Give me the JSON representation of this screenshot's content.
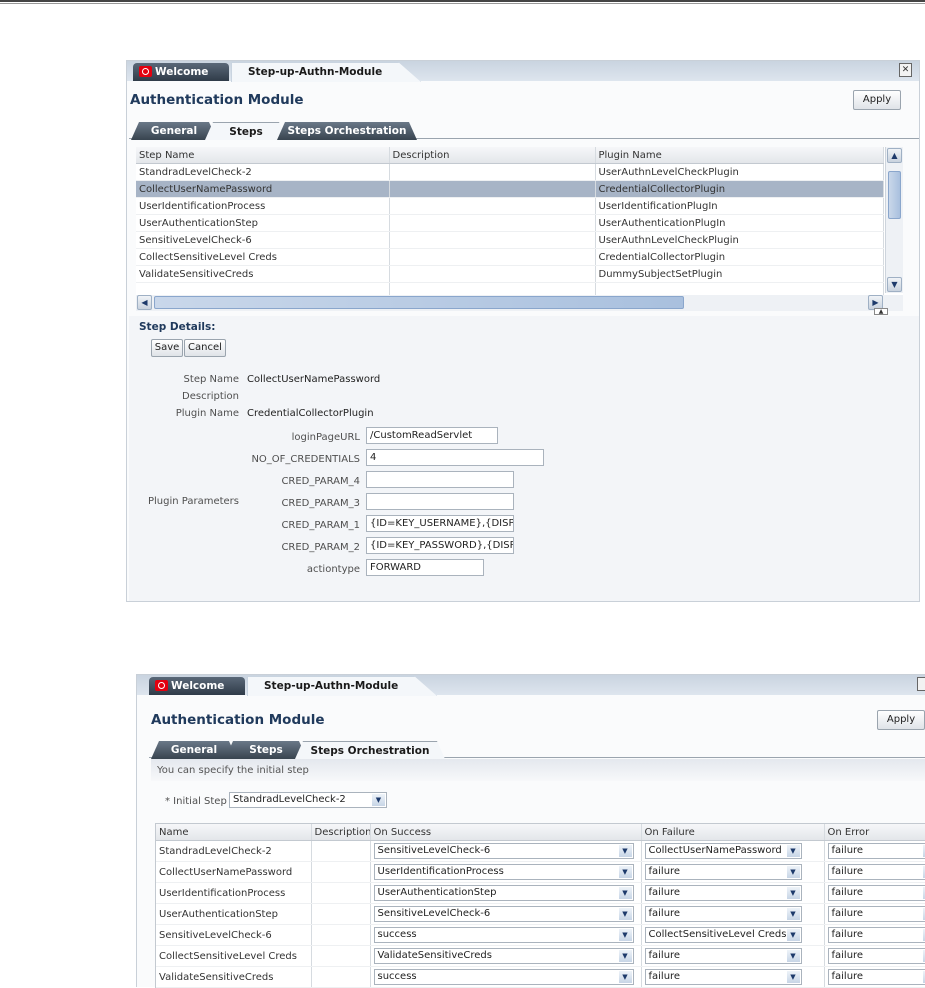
{
  "top": {
    "welcome_tab": "Welcome",
    "module_tab": "Step-up-Authn-Module",
    "title": "Authentication Module",
    "apply": "Apply",
    "subtabs": [
      "General",
      "Steps",
      "Steps Orchestration"
    ],
    "table": {
      "headers": [
        "Step Name",
        "Description",
        "Plugin Name"
      ],
      "rows": [
        {
          "name": "StandradLevelCheck-2",
          "description": "",
          "plugin": "UserAuthnLevelCheckPlugin"
        },
        {
          "name": "CollectUserNamePassword",
          "description": "",
          "plugin": "CredentialCollectorPlugin"
        },
        {
          "name": "UserIdentificationProcess",
          "description": "",
          "plugin": "UserIdentificationPlugIn"
        },
        {
          "name": "UserAuthenticationStep",
          "description": "",
          "plugin": "UserAuthenticationPlugIn"
        },
        {
          "name": "SensitiveLevelCheck-6",
          "description": "",
          "plugin": "UserAuthnLevelCheckPlugin"
        },
        {
          "name": "CollectSensitiveLevel Creds",
          "description": "",
          "plugin": "CredentialCollectorPlugin"
        },
        {
          "name": "ValidateSensitiveCreds",
          "description": "",
          "plugin": "DummySubjectSetPlugin"
        }
      ],
      "selected_index": 1
    },
    "details": {
      "heading": "Step Details:",
      "save": "Save",
      "cancel": "Cancel",
      "step_name_label": "Step Name",
      "step_name_value": "CollectUserNamePassword",
      "description_label": "Description",
      "plugin_name_label": "Plugin Name",
      "plugin_name_value": "CredentialCollectorPlugin",
      "plugin_params_label": "Plugin Parameters",
      "params": [
        {
          "label": "loginPageURL",
          "value": "/CustomReadServlet"
        },
        {
          "label": "NO_OF_CREDENTIALS",
          "value": "4"
        },
        {
          "label": "CRED_PARAM_4",
          "value": ""
        },
        {
          "label": "CRED_PARAM_3",
          "value": ""
        },
        {
          "label": "CRED_PARAM_1",
          "value": "{ID=KEY_USERNAME},{DISPLAY_NA"
        },
        {
          "label": "CRED_PARAM_2",
          "value": "{ID=KEY_PASSWORD},{DISPLAY_N"
        },
        {
          "label": "actiontype",
          "value": "FORWARD"
        }
      ]
    }
  },
  "bottom": {
    "welcome_tab": "Welcome",
    "module_tab": "Step-up-Authn-Module",
    "title": "Authentication Module",
    "apply": "Apply",
    "subtabs": [
      "General",
      "Steps",
      "Steps Orchestration"
    ],
    "info": "You can specify the initial step",
    "initial_step_label": "* Initial Step",
    "initial_step_value": "StandradLevelCheck-2",
    "table": {
      "headers": [
        "Name",
        "Description",
        "On Success",
        "On Failure",
        "On Error"
      ],
      "rows": [
        {
          "name": "StandradLevelCheck-2",
          "description": "",
          "success": "SensitiveLevelCheck-6",
          "failure": "CollectUserNamePassword",
          "error": "failure"
        },
        {
          "name": "CollectUserNamePassword",
          "description": "",
          "success": "UserIdentificationProcess",
          "failure": "failure",
          "error": "failure"
        },
        {
          "name": "UserIdentificationProcess",
          "description": "",
          "success": "UserAuthenticationStep",
          "failure": "failure",
          "error": "failure"
        },
        {
          "name": "UserAuthenticationStep",
          "description": "",
          "success": "SensitiveLevelCheck-6",
          "failure": "failure",
          "error": "failure"
        },
        {
          "name": "SensitiveLevelCheck-6",
          "description": "",
          "success": "success",
          "failure": "CollectSensitiveLevel Creds",
          "error": "failure"
        },
        {
          "name": "CollectSensitiveLevel Creds",
          "description": "",
          "success": "ValidateSensitiveCreds",
          "failure": "failure",
          "error": "failure"
        },
        {
          "name": "ValidateSensitiveCreds",
          "description": "",
          "success": "success",
          "failure": "failure",
          "error": "failure"
        }
      ]
    }
  }
}
